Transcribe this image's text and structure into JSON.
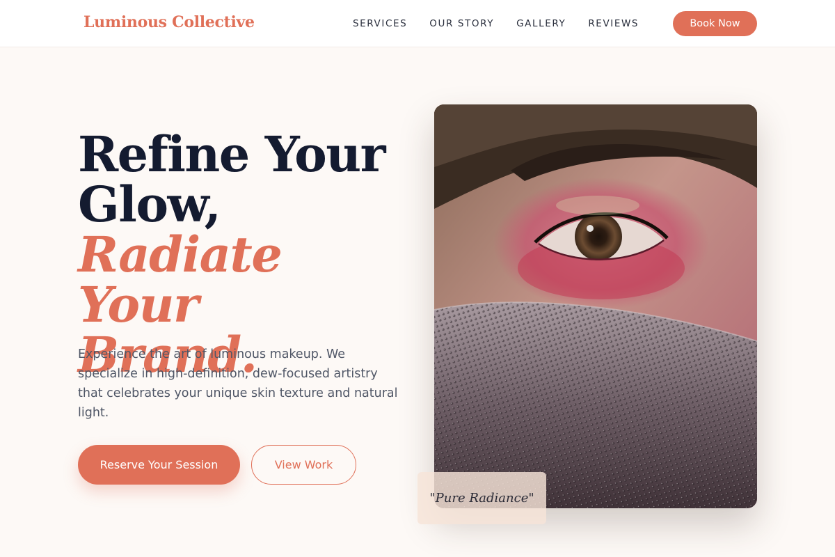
{
  "brand": {
    "name": "Luminous Collective"
  },
  "nav": {
    "items": [
      {
        "label": "SERVICES"
      },
      {
        "label": "OUR STORY"
      },
      {
        "label": "GALLERY"
      },
      {
        "label": "REVIEWS"
      }
    ],
    "cta_label": "Book Now"
  },
  "hero": {
    "headline": {
      "line1": "Refine Your",
      "line2": "Glow,",
      "accent_line1": "Radiate Your",
      "accent_line2": "Brand."
    },
    "description": "Experience the art of luminous makeup. We specialize in high-definition, dew-focused artistry that celebrates your unique skin texture and natural light.",
    "primary_cta": "Reserve Your Session",
    "secondary_cta": "View Work",
    "image_caption": "\"Pure Radiance\""
  },
  "colors": {
    "accent": "#e07058",
    "headline": "#141b30",
    "background": "#fdf9f6",
    "body_text": "#4f5666"
  }
}
